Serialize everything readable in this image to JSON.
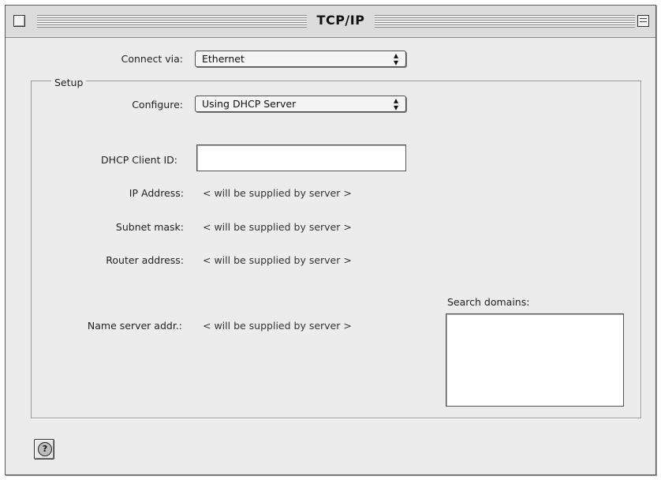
{
  "window": {
    "title": "TCP/IP"
  },
  "connect": {
    "label": "Connect via:",
    "value": "Ethernet"
  },
  "setup": {
    "group_label": "Setup",
    "configure": {
      "label": "Configure:",
      "value": "Using DHCP Server"
    },
    "dhcp_client_id": {
      "label": "DHCP Client ID:",
      "value": ""
    },
    "ip_address": {
      "label": "IP Address:",
      "value": "< will be supplied by server >"
    },
    "subnet_mask": {
      "label": "Subnet mask:",
      "value": "< will be supplied by server >"
    },
    "router_address": {
      "label": "Router address:",
      "value": "< will be supplied by server >"
    },
    "name_server": {
      "label": "Name server addr.:",
      "value": "< will be supplied by server >"
    },
    "search_domains": {
      "label": "Search domains:",
      "value": ""
    }
  },
  "icons": {
    "help": "help-icon",
    "close": "close-box-icon",
    "zoom": "zoom-box-icon"
  },
  "colors": {
    "window_bg": "#ececec",
    "border": "#5a5a5a"
  }
}
